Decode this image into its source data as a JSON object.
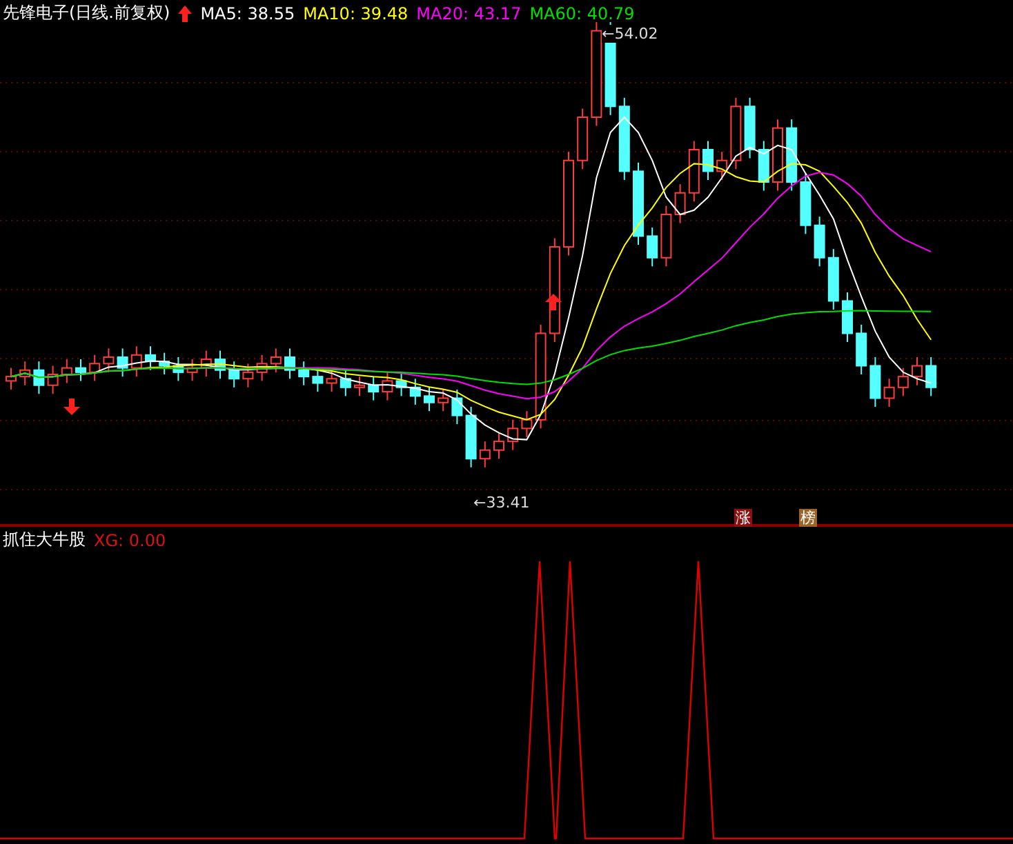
{
  "main_chart": {
    "title": "先锋电子(日线.前复权)",
    "ma_readings": [
      {
        "label": "MA5: 38.55",
        "color": "#ffffff"
      },
      {
        "label": "MA10: 39.48",
        "color": "#ffff00"
      },
      {
        "label": "MA20: 43.17",
        "color": "#ff00ff"
      },
      {
        "label": "MA60: 40.79",
        "color": "#00e000"
      }
    ],
    "high_label": "←54.02",
    "low_label": "←33.41",
    "tags": [
      {
        "text": "涨",
        "color": "#8b1010"
      },
      {
        "text": "榜",
        "color": "#9c6428"
      }
    ]
  },
  "indicator": {
    "title": "抓住大牛股",
    "reading": "XG: 0.00"
  }
}
